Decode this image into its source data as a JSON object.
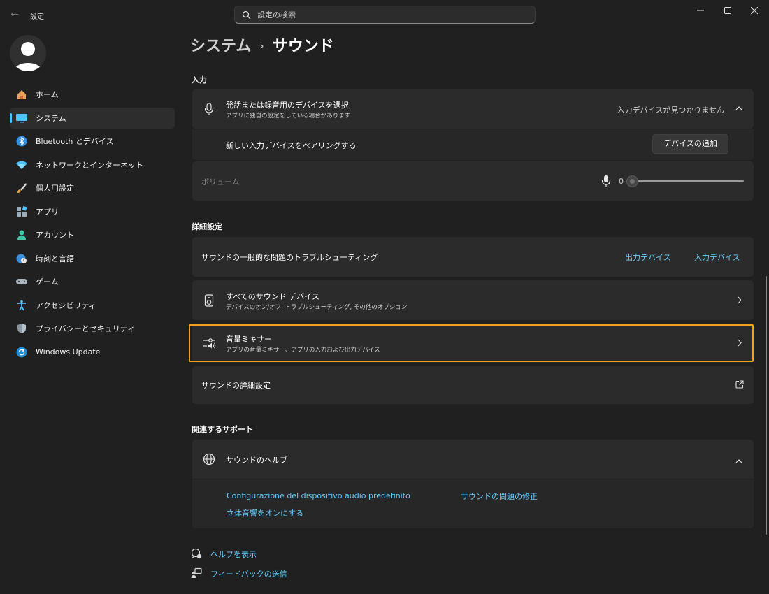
{
  "window": {
    "app_title": "設定",
    "search_placeholder": "設定の検索"
  },
  "sidebar": {
    "items": [
      {
        "label": "ホーム",
        "icon": "home-icon"
      },
      {
        "label": "システム",
        "icon": "system-icon"
      },
      {
        "label": "Bluetooth とデバイス",
        "icon": "bluetooth-icon"
      },
      {
        "label": "ネットワークとインターネット",
        "icon": "wifi-icon"
      },
      {
        "label": "個人用設定",
        "icon": "brush-icon"
      },
      {
        "label": "アプリ",
        "icon": "apps-icon"
      },
      {
        "label": "アカウント",
        "icon": "account-icon"
      },
      {
        "label": "時刻と言語",
        "icon": "globe-clock-icon"
      },
      {
        "label": "ゲーム",
        "icon": "gamepad-icon"
      },
      {
        "label": "アクセシビリティ",
        "icon": "accessibility-icon"
      },
      {
        "label": "プライバシーとセキュリティ",
        "icon": "shield-icon"
      },
      {
        "label": "Windows Update",
        "icon": "update-icon"
      }
    ],
    "active_index": 1
  },
  "breadcrumb": {
    "parent": "システム",
    "separator": "›",
    "current": "サウンド"
  },
  "input_section": {
    "heading": "入力",
    "device_select": {
      "title": "発話または録音用のデバイスを選択",
      "description": "アプリに独自の設定をしている場合があります",
      "status": "入力デバイスが見つかりません"
    },
    "pair": {
      "title": "新しい入力デバイスをペアリングする",
      "button": "デバイスの追加"
    },
    "volume": {
      "label": "ボリューム",
      "value": "0"
    }
  },
  "advanced_section": {
    "heading": "詳細設定",
    "troubleshoot": {
      "title": "サウンドの一般的な問題のトラブルシューティング",
      "link_output": "出力デバイス",
      "link_input": "入力デバイス"
    },
    "all_devices": {
      "title": "すべてのサウンド デバイス",
      "description": "デバイスのオン/オフ, トラブルシューティング, その他のオプション"
    },
    "mixer": {
      "title": "音量ミキサー",
      "description": "アプリの音量ミキサー、アプリの入力および出力デバイス"
    },
    "more": {
      "title": "サウンドの詳細設定"
    }
  },
  "support_section": {
    "heading": "関連するサポート",
    "help": {
      "title": "サウンドのヘルプ",
      "links": [
        "Configurazione del dispositivo audio predefinito",
        "サウンドの問題の修正",
        "立体音響をオンにする"
      ]
    }
  },
  "footer": {
    "help": "ヘルプを表示",
    "feedback": "フィードバックの送信"
  },
  "colors": {
    "accent": "#60cdff",
    "highlight": "#f0a020",
    "background": "#202020",
    "card": "#2b2b2b"
  }
}
